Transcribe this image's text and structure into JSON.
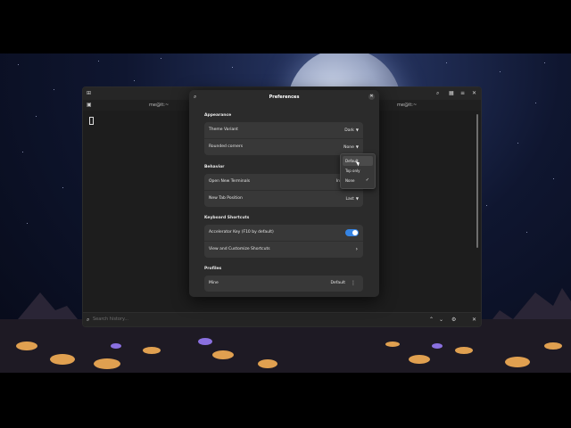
{
  "terminal": {
    "tab_left": "me@it:~",
    "tab_right": "me@it:~",
    "search_placeholder": "Search history..."
  },
  "preferences": {
    "title": "Preferences",
    "sections": {
      "appearance": "Appearance",
      "behavior": "Behavior",
      "shortcuts": "Keyboard Shortcuts",
      "profiles": "Profiles"
    },
    "appearance": {
      "theme_label": "Theme Variant",
      "theme_value": "Dark",
      "rounded_label": "Rounded corners",
      "rounded_value": "None"
    },
    "behavior": {
      "open_label": "Open New Terminals",
      "open_value": "In",
      "tabpos_label": "New Tab Position",
      "tabpos_value": "Last"
    },
    "shortcuts": {
      "accel_label": "Accelerator Key (F10 by default)",
      "accel_on": true,
      "customize_label": "View and Customize Shortcuts"
    },
    "profiles": {
      "name": "Mine",
      "badge": "Default"
    }
  },
  "dropdown": {
    "options": [
      "Default",
      "Top only",
      "None"
    ],
    "selected": "None",
    "hovered": "Default"
  },
  "icons": {
    "new_tab": "plus-icon",
    "tab_overview": "overview-icon",
    "search": "search-icon",
    "grid": "grid-icon",
    "menu": "hamburger-icon",
    "close": "close-icon"
  },
  "colors": {
    "accent": "#3584e4",
    "dialog_bg": "#2b2b2b",
    "row_bg": "#383838"
  }
}
